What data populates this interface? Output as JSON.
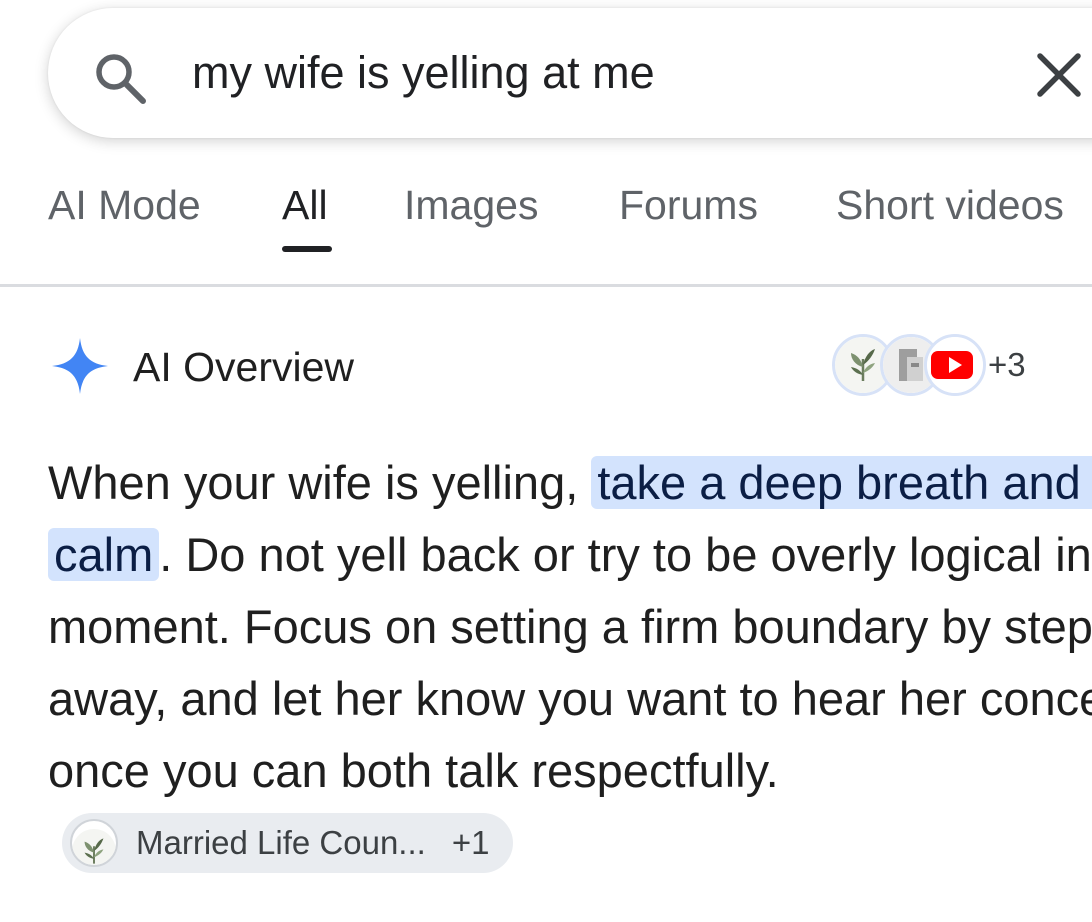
{
  "search": {
    "query": "my wife is yelling at me"
  },
  "tabs": [
    {
      "label": "AI Mode",
      "active": false
    },
    {
      "label": "All",
      "active": true
    },
    {
      "label": "Images",
      "active": false
    },
    {
      "label": "Forums",
      "active": false
    },
    {
      "label": "Short videos",
      "active": false
    }
  ],
  "ai_overview": {
    "title": "AI Overview",
    "sources_more": "+3",
    "answer": {
      "before": "When your wife is yelling, ",
      "highlight": "take a deep breath and stay calm",
      "after": ". Do not yell back or try to be overly logical in the moment. Focus on setting a firm boundary by stepping away, and let her know you want to hear her concerns once you can both talk respectfully."
    },
    "citation": {
      "label": "Married Life Coun...",
      "more": "+1"
    }
  },
  "colors": {
    "accent_blue": "#4285f4",
    "highlight_bg": "#d3e3fd",
    "youtube_red": "#ff0000"
  },
  "icons": [
    "search-icon",
    "close-icon",
    "sparkle-icon",
    "leaf-logo-icon",
    "document-icon",
    "youtube-icon"
  ]
}
